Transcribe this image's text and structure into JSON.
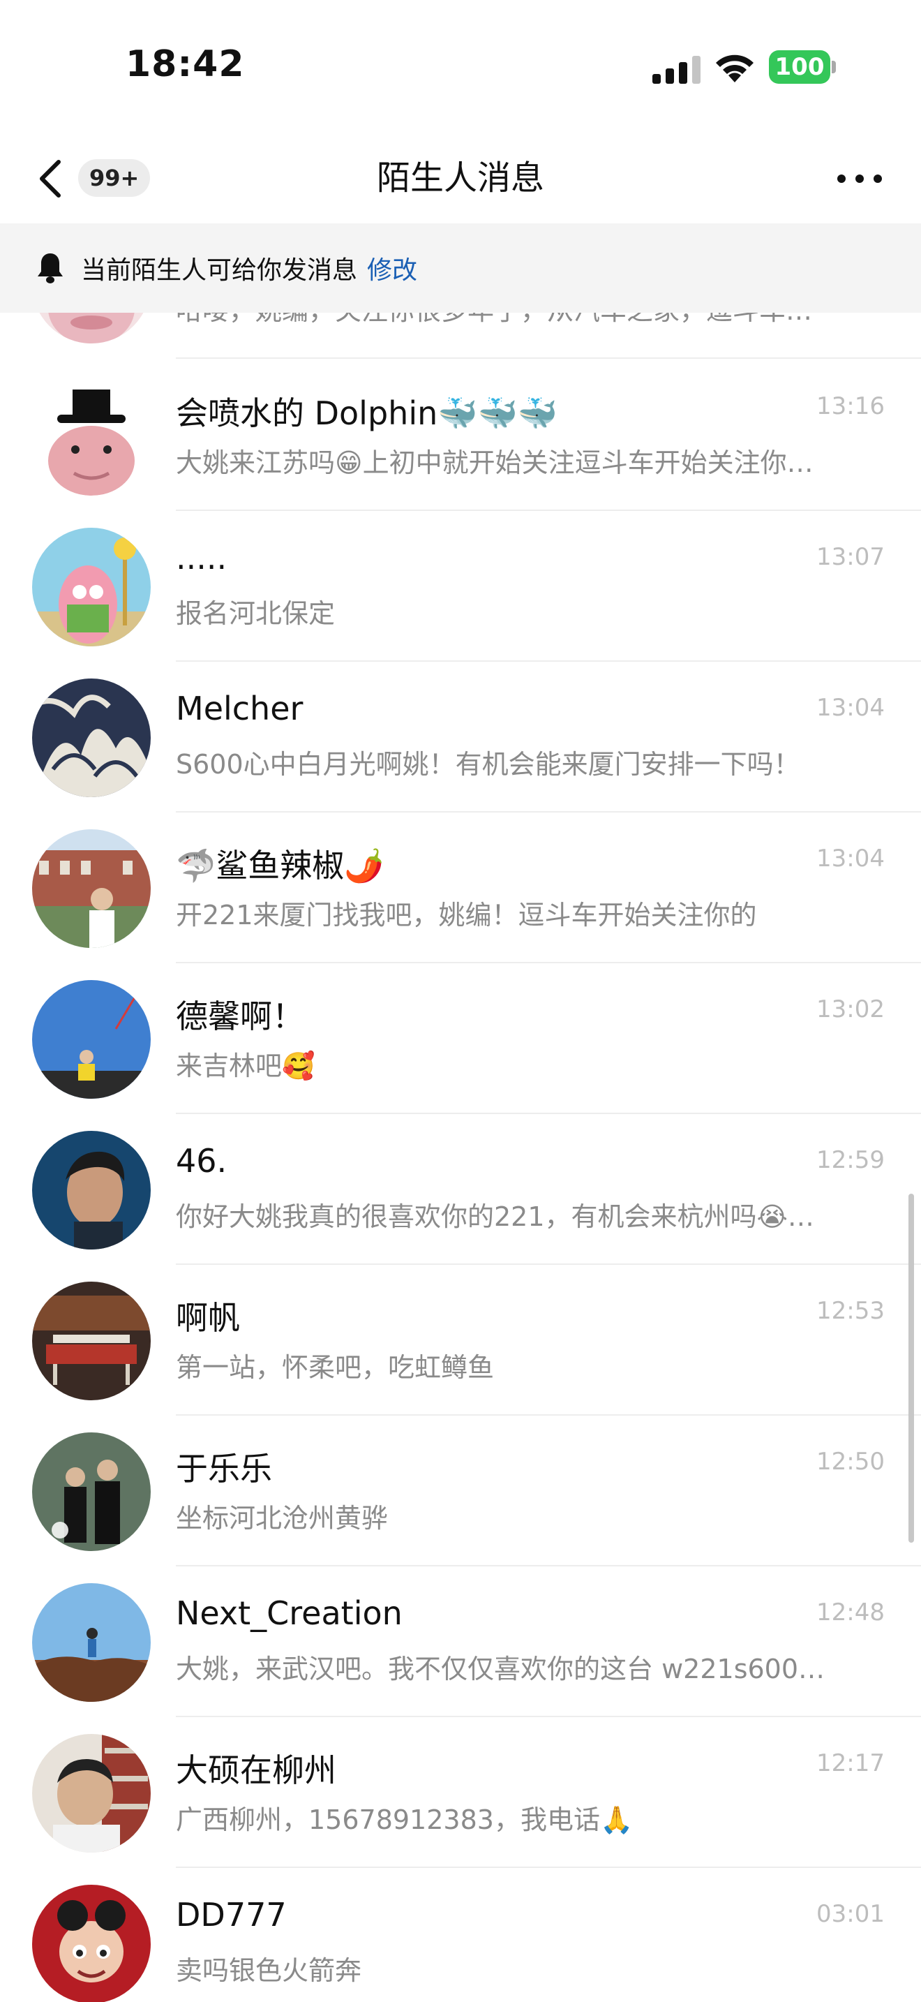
{
  "status_bar": {
    "time": "18:42",
    "battery": "100"
  },
  "nav": {
    "badge": "99+",
    "title": "陌生人消息"
  },
  "notice": {
    "text": "当前陌生人可给你发消息",
    "action": "修改"
  },
  "conversations": [
    {
      "name": "",
      "time": "",
      "preview": "哈喽，姚编，关注你很多年了，从汽车之家，逗斗车…"
    },
    {
      "name": "会喷水的 Dolphin🐳🐳🐳",
      "time": "13:16",
      "preview": "大姚来江苏吗😁上初中就开始关注逗斗车开始关注你…"
    },
    {
      "name": ".....",
      "time": "13:07",
      "preview": "报名河北保定"
    },
    {
      "name": "Melcher",
      "time": "13:04",
      "preview": "S600心中白月光啊姚！有机会能来厦门安排一下吗！"
    },
    {
      "name": "🦈鲨鱼辣椒🌶️",
      "time": "13:04",
      "preview": "开221来厦门找我吧，姚编！逗斗车开始关注你的"
    },
    {
      "name": "德馨啊！",
      "time": "13:02",
      "preview": "来吉林吧🥰"
    },
    {
      "name": "46.",
      "time": "12:59",
      "preview": "你好大姚我真的很喜欢你的221，有机会来杭州吗😭…"
    },
    {
      "name": "啊帆",
      "time": "12:53",
      "preview": "第一站，怀柔吧，吃虹鳟鱼"
    },
    {
      "name": "于乐乐",
      "time": "12:50",
      "preview": "坐标河北沧州黄骅"
    },
    {
      "name": "Next_Creation",
      "time": "12:48",
      "preview": "大姚，来武汉吧。我不仅仅喜欢你的这台 w221s600…"
    },
    {
      "name": "大硕在柳州",
      "time": "12:17",
      "preview": "广西柳州，15678912383，我电话🙏"
    },
    {
      "name": "DD777",
      "time": "03:01",
      "preview": "卖吗银色火箭奔"
    }
  ]
}
